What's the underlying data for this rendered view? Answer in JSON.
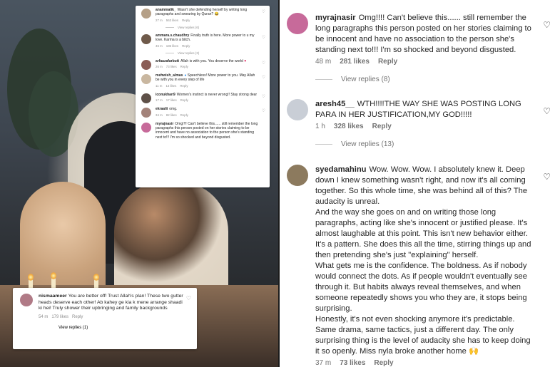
{
  "left_cards": {
    "top_comments": [
      {
        "username": "anammalik_",
        "text": "Wasn't she defending herself by writing long paragraphs and swearing by Quran?",
        "time": "27 m",
        "likes": "563 likes",
        "reply": "Reply",
        "view_replies": "View replies (6)",
        "avatar_color": "#b5a088"
      },
      {
        "username": "ammara.s.chaudhry",
        "text": "Finally truth is here. More power to u my love. Karma is a bitch.",
        "time": "46 m",
        "likes": "186 likes",
        "reply": "Reply",
        "view_replies": "View replies (3)",
        "avatar_color": "#6f5a4a"
      },
      {
        "username": "arfaazafarbutt",
        "text": "Allah is with you. You deserve the world",
        "time": "26 m",
        "likes": "73 likes",
        "reply": "Reply",
        "avatar_color": "#8a5d56"
      },
      {
        "username": "mehwish_almas",
        "text": "Speechless! More power to you. May Allah be with you in every step of life",
        "time": "11 m",
        "likes": "13 likes",
        "reply": "Reply",
        "avatar_color": "#c9b7a0"
      },
      {
        "username": "iconukhan9",
        "text": "Women's instinct is never wrong!! Stay strong dear",
        "time": "17 m",
        "likes": "17 likes",
        "reply": "Reply",
        "avatar_color": "#5e5048"
      },
      {
        "username": "ekraalii",
        "text": "omg.",
        "time": "34 m",
        "likes": "82 likes",
        "reply": "Reply",
        "avatar_color": "#a3837a"
      },
      {
        "username": "myrajnasir",
        "text": "Omg!!!! Can't believe this...... still remember the long paragraphs this person posted on her stories claiming to be innocent and have no association to the person she's standing next to!!! I'm so shocked and beyond disgusted.",
        "time": "",
        "likes": "",
        "reply": "",
        "avatar_color": "#c76a9a"
      }
    ],
    "bottom_comment": {
      "username": "nismaameer",
      "text": "You are better off! Trust Allah's plan! These two gutter heads deserve each other! Ab kahey ge kia k mene arrange shaadi ki hei! Truly shower their upbringing and family backgrounds",
      "time": "54 m",
      "likes": "179 likes",
      "reply": "Reply",
      "view_replies": "View replies (1)",
      "avatar_color": "#b07a86"
    }
  },
  "comments": [
    {
      "username": "myrajnasir",
      "paragraphs": [
        "Omg!!!! Can't believe this...... still remember the long paragraphs this person posted on her stories claiming to be innocent and have no association to the person she's standing next to!!! I'm so shocked and beyond disgusted."
      ],
      "time": "48 m",
      "likes": "281 likes",
      "reply": "Reply",
      "view_replies": "View replies (8)",
      "avatar_color": "#c76a9a"
    },
    {
      "username": "aresh45__",
      "paragraphs": [
        "WTH!!!!THE WAY SHE WAS POSTING LONG PARA IN HER JUSTIFICATION,MY GOD!!!!!"
      ],
      "time": "1 h",
      "likes": "328 likes",
      "reply": "Reply",
      "view_replies": "View replies (13)",
      "avatar_color": "#c9ced6"
    },
    {
      "username": "syedamahinu",
      "paragraphs": [
        "Wow. Wow. Wow. I absolutely knew it. Deep down I knew something wasn't right, and now it's all coming together. So this whole time, she was behind all of this? The audacity is unreal.",
        "And the way she goes on and on writing those long paragraphs, acting like she's innocent or justified please. It's almost laughable at this point. This isn't new behavior either. It's a pattern. She does this all the time, stirring things up and then pretending she's just \"explaining\" herself.",
        "What gets me is the confidence. The boldness. As if nobody would connect the dots. As if people wouldn't eventually see through it. But habits always reveal themselves, and when someone repeatedly shows you who they are, it stops being surprising.",
        "Honestly, it's not even shocking anymore it's predictable. Same drama, same tactics, just a different day. The only surprising thing is the level of audacity she has to keep doing it so openly. Miss nyla broke another home 🙌"
      ],
      "time": "37 m",
      "likes": "73 likes",
      "reply": "Reply",
      "avatar_color": "#8c7a5e"
    }
  ]
}
